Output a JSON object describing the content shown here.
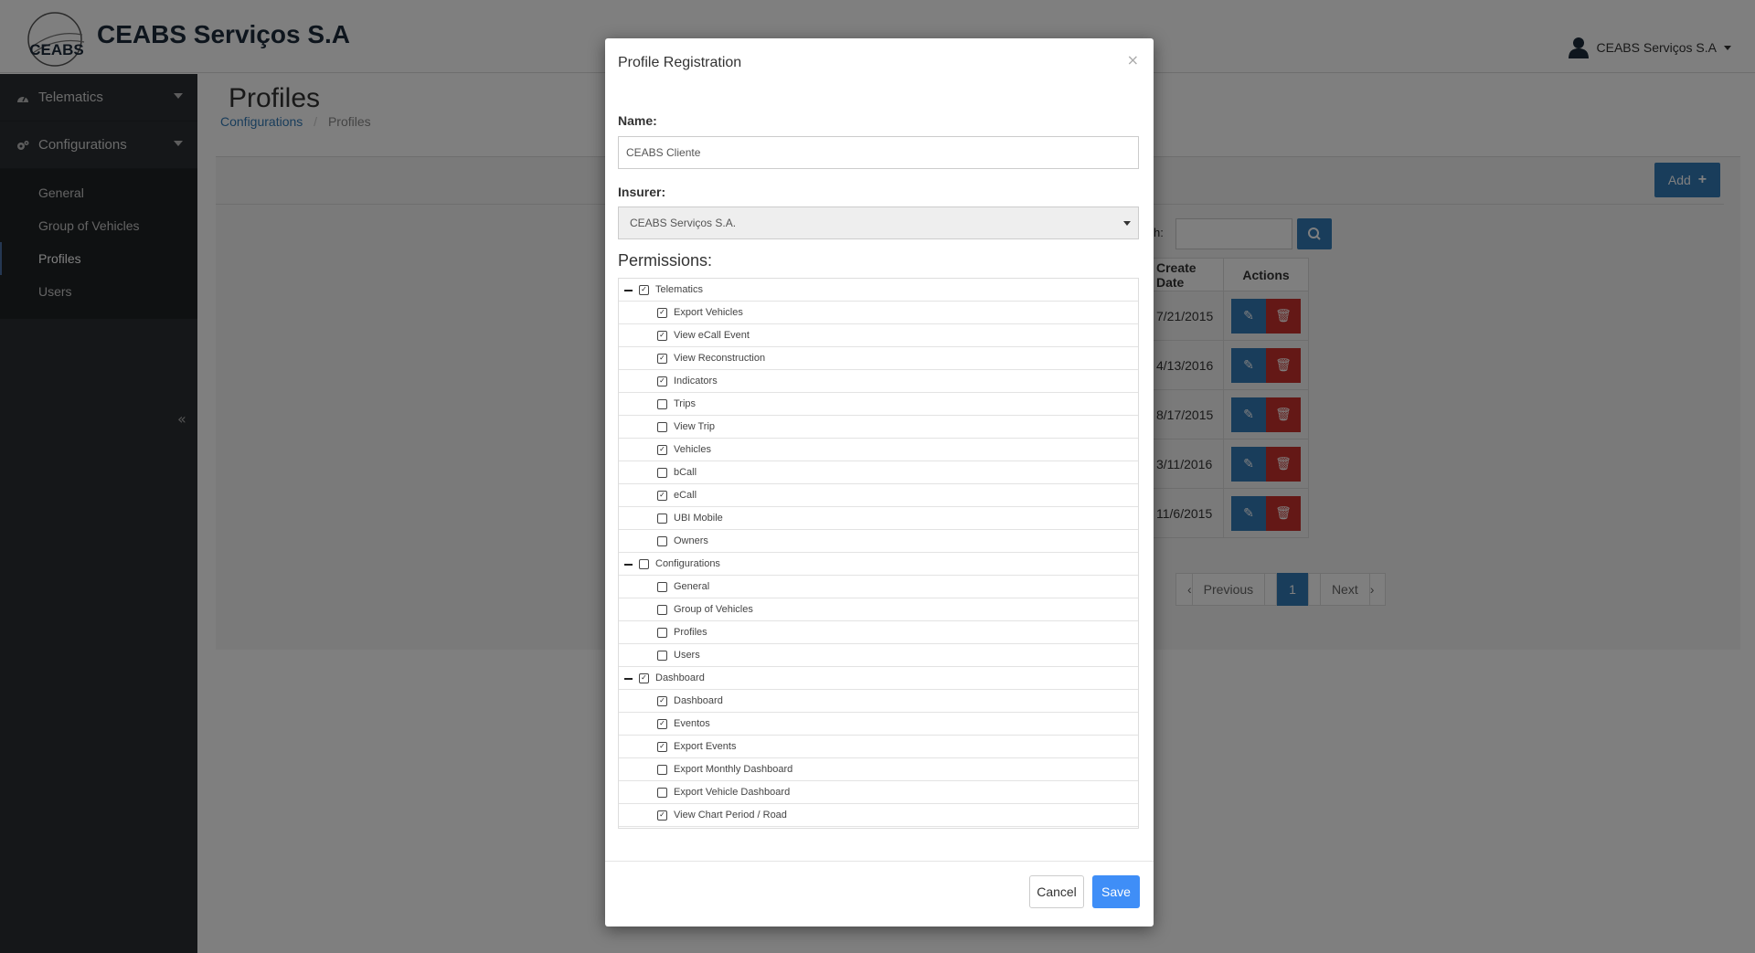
{
  "header": {
    "brand": "CEABS Serviços S.A",
    "logo_text": "CEABS",
    "user_name": "CEABS Serviços S.A"
  },
  "sidebar": {
    "groups": [
      {
        "label": "Telematics",
        "icon": "dashboard-icon"
      },
      {
        "label": "Configurations",
        "icon": "cogs-icon"
      }
    ],
    "items": [
      {
        "label": "General"
      },
      {
        "label": "Group of Vehicles"
      },
      {
        "label": "Profiles"
      },
      {
        "label": "Users"
      }
    ],
    "active_item": "Profiles"
  },
  "page": {
    "title": "Profiles",
    "breadcrumb": [
      "Configurations",
      "Profiles"
    ],
    "add_label": "Add",
    "search_label": "h:",
    "table": {
      "headers": [
        "Create Date",
        "Actions"
      ],
      "rows": [
        {
          "date": "7/21/2015"
        },
        {
          "date": "4/13/2016"
        },
        {
          "date": "8/17/2015"
        },
        {
          "date": "3/11/2016"
        },
        {
          "date": "11/6/2015"
        }
      ]
    },
    "pagination": {
      "prev": "Previous",
      "current": "1",
      "next": "Next"
    }
  },
  "modal": {
    "title": "Profile Registration",
    "close": "×",
    "name_label": "Name:",
    "name_value": "CEABS Cliente",
    "insurer_label": "Insurer:",
    "insurer_value": "CEABS Serviços S.A.",
    "permissions_label": "Permissions:",
    "permissions": [
      {
        "label": "Telematics",
        "type": "group",
        "checked": true
      },
      {
        "label": "Export Vehicles",
        "type": "item",
        "checked": true
      },
      {
        "label": "View eCall Event",
        "type": "item",
        "checked": true
      },
      {
        "label": "View Reconstruction",
        "type": "item",
        "checked": true
      },
      {
        "label": "Indicators",
        "type": "item",
        "checked": true
      },
      {
        "label": "Trips",
        "type": "item",
        "checked": false
      },
      {
        "label": "View Trip",
        "type": "item",
        "checked": false
      },
      {
        "label": "Vehicles",
        "type": "item",
        "checked": true
      },
      {
        "label": "bCall",
        "type": "item",
        "checked": false
      },
      {
        "label": "eCall",
        "type": "item",
        "checked": true
      },
      {
        "label": "UBI Mobile",
        "type": "item",
        "checked": false
      },
      {
        "label": "Owners",
        "type": "item",
        "checked": false
      },
      {
        "label": "Configurations",
        "type": "group",
        "checked": false
      },
      {
        "label": "General",
        "type": "item",
        "checked": false
      },
      {
        "label": "Group of Vehicles",
        "type": "item",
        "checked": false
      },
      {
        "label": "Profiles",
        "type": "item",
        "checked": false
      },
      {
        "label": "Users",
        "type": "item",
        "checked": false
      },
      {
        "label": "Dashboard",
        "type": "group",
        "checked": true
      },
      {
        "label": "Dashboard",
        "type": "item",
        "checked": true
      },
      {
        "label": "Eventos",
        "type": "item",
        "checked": true
      },
      {
        "label": "Export Events",
        "type": "item",
        "checked": true
      },
      {
        "label": "Export Monthly Dashboard",
        "type": "item",
        "checked": false
      },
      {
        "label": "Export Vehicle Dashboard",
        "type": "item",
        "checked": false
      },
      {
        "label": "View Chart Period / Road",
        "type": "item",
        "checked": true
      }
    ],
    "cancel_label": "Cancel",
    "save_label": "Save"
  },
  "colors": {
    "primary": "#337ab7",
    "danger": "#c9302c",
    "save": "#3f8ef7",
    "sidebar_bg": "#2a2f33"
  }
}
